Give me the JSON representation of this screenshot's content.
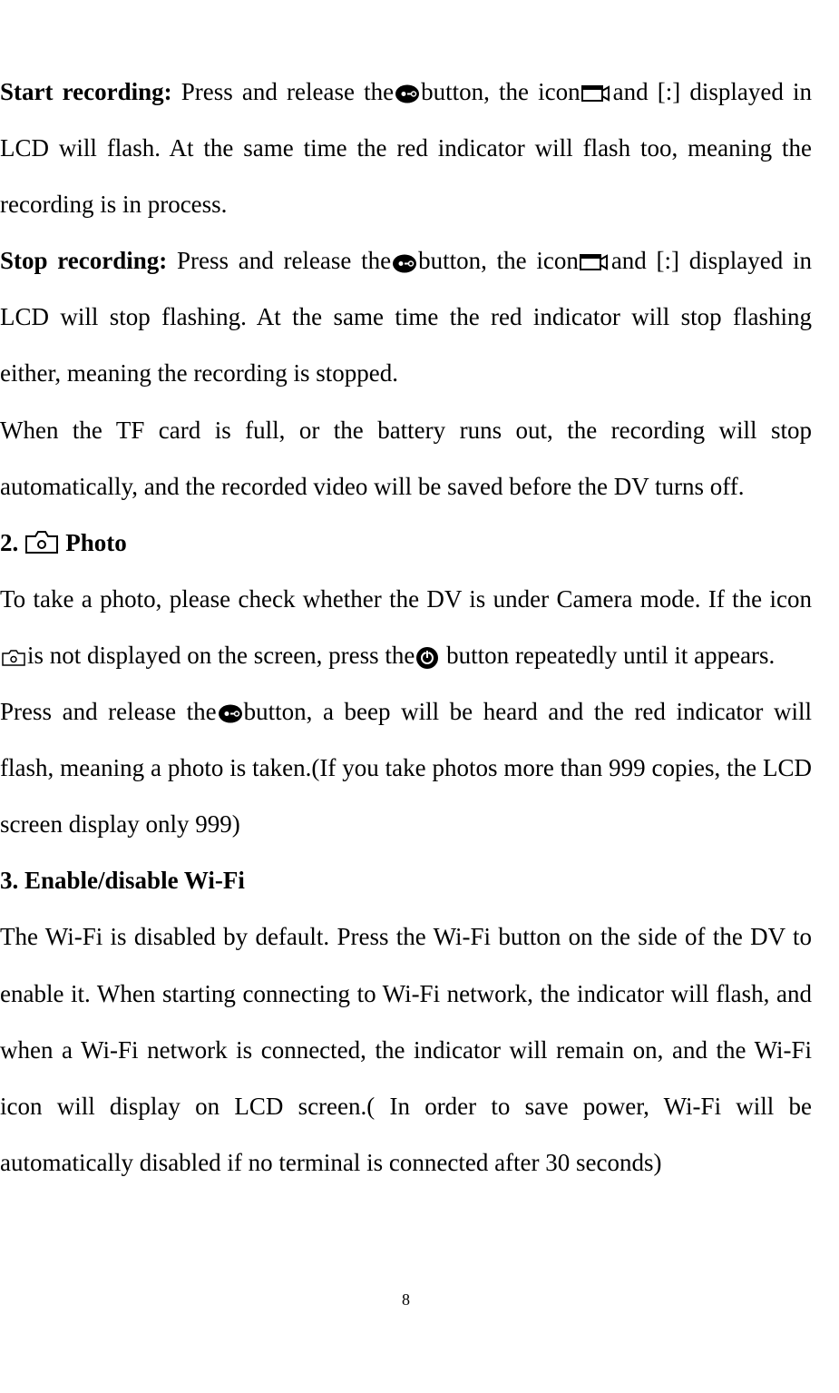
{
  "p1": {
    "label": "Start recording:",
    "t1": " Press and release the",
    "t2": "button, the icon",
    "t3": "and [:] displayed in LCD will flash. At the same time the red indicator will flash too, meaning the recording is in process."
  },
  "p2": {
    "label": "Stop recording:",
    "t1": " Press and release the",
    "t2": "button, the icon",
    "t3": "and [:] displayed in LCD will stop flashing. At the same time the red indicator will stop flashing either, meaning the recording is stopped."
  },
  "p3": "When the TF card is full, or the battery runs out, the recording will stop automatically, and the recorded video will be saved before the DV turns off.",
  "section2": {
    "num": "2.",
    "title": "Photo"
  },
  "p4": {
    "t1": "To take a photo, please check whether the DV is under Camera mode. If the icon ",
    "t2": "is not displayed on the screen, press the",
    "t3": " button repeatedly until it appears."
  },
  "p5": {
    "t1": "Press and release the",
    "t2": "button, a beep will be heard and the red indicator will flash, meaning a photo is taken.(If you take photos more than 999 copies, the LCD screen display only 999)"
  },
  "section3": {
    "title": "3. Enable/disable Wi-Fi"
  },
  "p6": "The Wi-Fi is disabled by default. Press the Wi-Fi button on the side of the DV to enable it. When starting connecting to Wi-Fi network, the indicator will flash, and when a Wi-Fi network is connected, the indicator will remain on, and the Wi-Fi icon will display on LCD screen.( In order to save power, Wi-Fi will be automatically disabled if no terminal is connected after 30 seconds)",
  "pageNumber": "8"
}
